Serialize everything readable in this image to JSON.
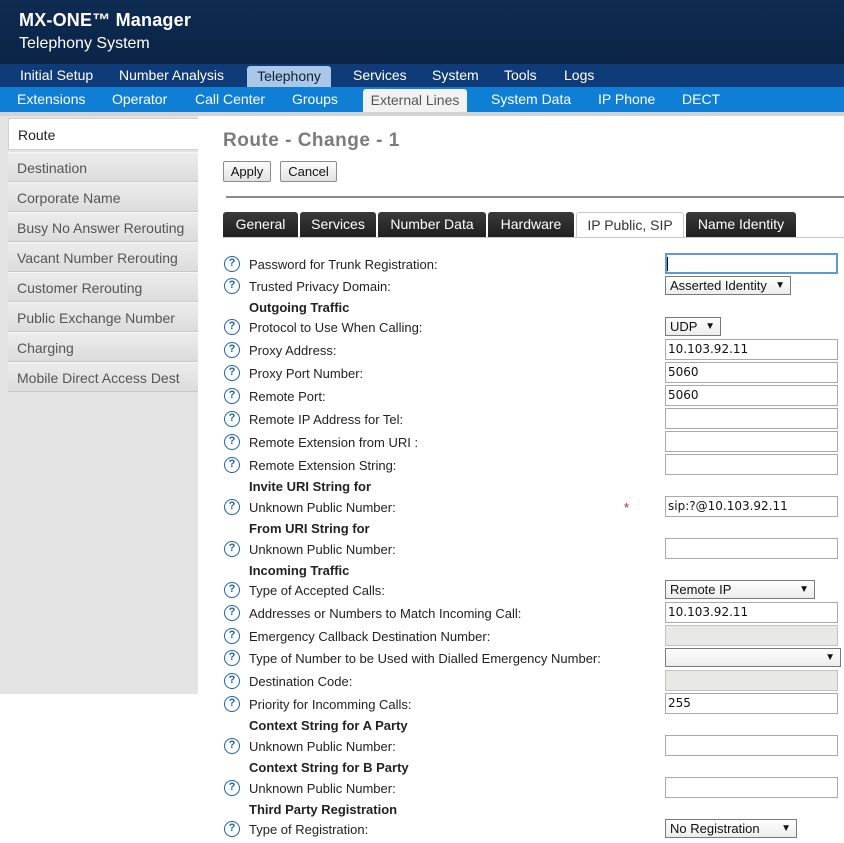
{
  "header": {
    "title": "MX-ONE™ Manager",
    "subtitle": "Telephony System"
  },
  "nav_primary": [
    "Initial Setup",
    "Number Analysis",
    "Telephony",
    "Services",
    "System",
    "Tools",
    "Logs"
  ],
  "nav_primary_active": "Telephony",
  "nav_secondary": [
    "Extensions",
    "Operator",
    "Call Center",
    "Groups",
    "External Lines",
    "System Data",
    "IP Phone",
    "DECT"
  ],
  "nav_secondary_active": "External Lines",
  "sidebar": [
    "Route",
    "Destination",
    "Corporate Name",
    "Busy No Answer Rerouting",
    "Vacant Number Rerouting",
    "Customer Rerouting",
    "Public Exchange Number",
    "Charging",
    "Mobile Direct Access Dest"
  ],
  "page": {
    "title": "Route - Change - 1",
    "apply": "Apply",
    "cancel": "Cancel"
  },
  "tabs": [
    "General",
    "Services",
    "Number Data",
    "Hardware",
    "IP Public, SIP",
    "Name Identity"
  ],
  "tab_active": "IP Public, SIP",
  "form": {
    "password_label": "Password for Trunk Registration:",
    "password_value": "",
    "privacy_label": "Trusted Privacy Domain:",
    "privacy_value": "Asserted Identity",
    "outgoing_heading": "Outgoing Traffic",
    "protocol_label": "Protocol to Use When Calling:",
    "protocol_value": "UDP",
    "proxy_label": "Proxy Address:",
    "proxy_value": "10.103.92.11",
    "proxy_port_label": "Proxy Port Number:",
    "proxy_port_value": "5060",
    "remote_port_label": "Remote Port:",
    "remote_port_value": "5060",
    "remote_ip_label": "Remote IP Address for Tel:",
    "remote_ip_value": "",
    "remote_ext_uri_label": "Remote Extension from URI :",
    "remote_ext_uri_value": "",
    "remote_ext_string_label": "Remote Extension String:",
    "remote_ext_string_value": "",
    "invite_heading": "Invite URI String for",
    "invite_unknown_label": "Unknown Public Number:",
    "required_mark": "*",
    "invite_unknown_value": "sip:?@10.103.92.11",
    "from_heading": "From URI String for",
    "from_unknown_label": "Unknown Public Number:",
    "from_unknown_value": "",
    "incoming_heading": "Incoming Traffic",
    "accepted_label": "Type of Accepted Calls:",
    "accepted_value": "Remote IP",
    "match_label": "Addresses or Numbers to Match Incoming Call:",
    "match_value": "10.103.92.11",
    "emergency_cb_label": "Emergency Callback Destination Number:",
    "emergency_cb_value": "",
    "emergency_type_label": "Type of Number to be Used with Dialled Emergency Number:",
    "emergency_type_value": "",
    "dest_code_label": "Destination Code:",
    "dest_code_value": "",
    "priority_label": "Priority for Incomming Calls:",
    "priority_value": "255",
    "context_a_heading": "Context String for A Party",
    "context_a_label": "Unknown Public Number:",
    "context_a_value": "",
    "context_b_heading": "Context String for B Party",
    "context_b_label": "Unknown Public Number:",
    "context_b_value": "",
    "third_party_heading": "Third Party Registration",
    "reg_type_label": "Type of Registration:",
    "reg_type_value": "No Registration"
  },
  "icons": {
    "help": "help-circle-icon",
    "dropdown": "chevron-down-icon"
  },
  "colors": {
    "header": "#0e2b52",
    "nav_primary": "#0f3c78",
    "nav_secondary": "#0e7fd4",
    "help_icon": "#1d62a8",
    "required": "#dd1111"
  }
}
